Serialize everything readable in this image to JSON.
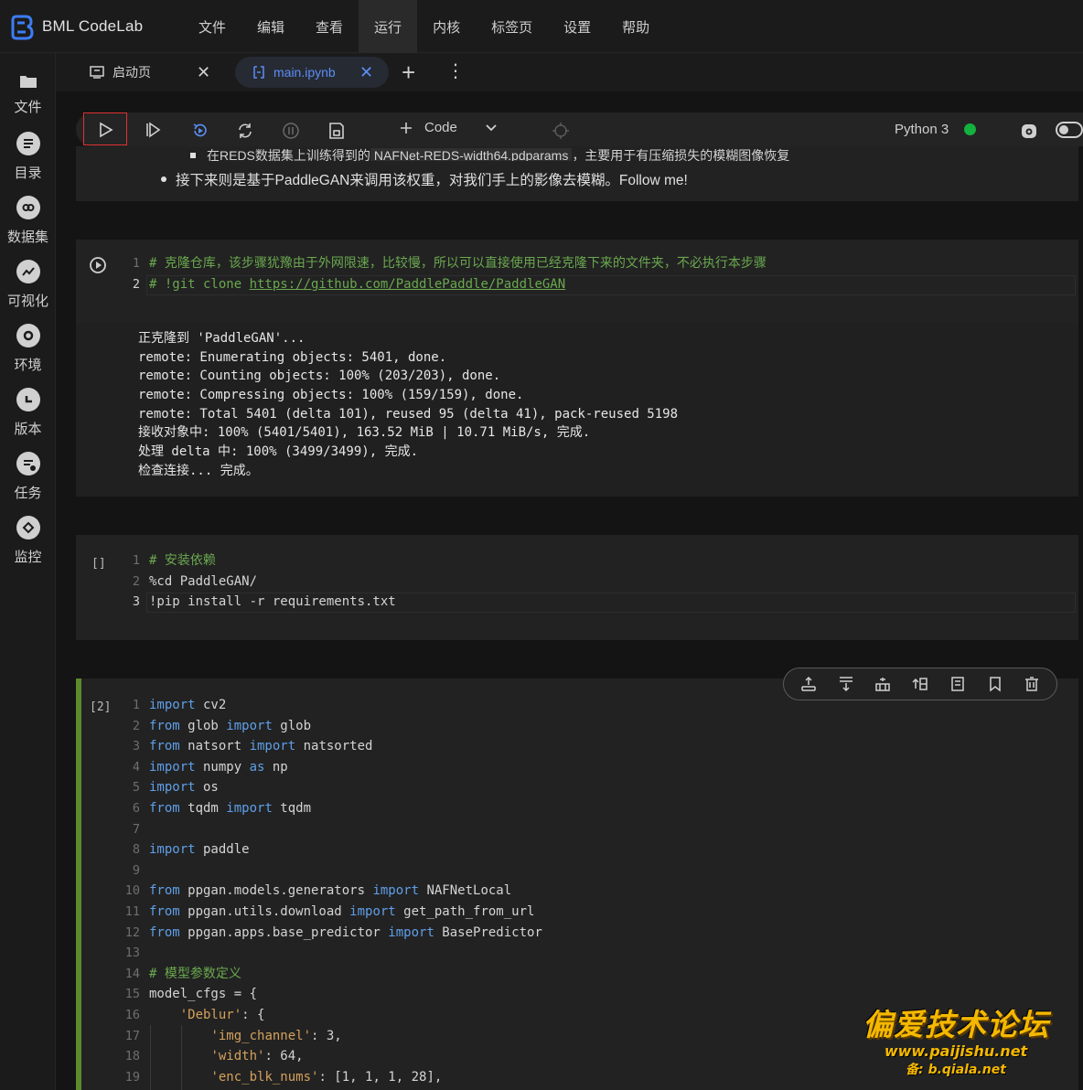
{
  "app": {
    "brand": "BML CodeLab"
  },
  "menu": [
    "文件",
    "编辑",
    "查看",
    "运行",
    "内核",
    "标签页",
    "设置",
    "帮助"
  ],
  "sidebar": [
    "文件",
    "目录",
    "数据集",
    "可视化",
    "环境",
    "版本",
    "任务",
    "监控"
  ],
  "tabs": {
    "start": "启动页",
    "notebook": "main.ipynb"
  },
  "toolbar": {
    "cell_type": "Code",
    "kernel": "Python 3",
    "kernel_status_color": "#13b13d"
  },
  "markdown": {
    "sub_prefix": "在REDS数据集上训练得到的",
    "sub_code": "NAFNet-REDS-width64.pdparams",
    "sub_suffix": "，主要用于有压缩损失的模糊图像恢复",
    "bullet": "接下来则是基于PaddleGAN来调用该权重，对我们手上的影像去模糊。Follow me!"
  },
  "cell1": {
    "line1": "# 克隆仓库，该步骤犹豫由于外网限速，比较慢，所以可以直接使用已经克隆下来的文件夹，不必执行本步骤",
    "line2_prefix": "# !git clone ",
    "line2_url": "https://github.com/PaddlePaddle/PaddleGAN"
  },
  "output": [
    "正克隆到 'PaddleGAN'...",
    "remote: Enumerating objects: 5401, done.",
    "remote: Counting objects: 100% (203/203), done.",
    "remote: Compressing objects: 100% (159/159), done.",
    "remote: Total 5401 (delta 101), reused 95 (delta 41), pack-reused 5198",
    "接收对象中: 100% (5401/5401), 163.52 MiB | 10.71 MiB/s, 完成.",
    "处理 delta 中: 100% (3499/3499), 完成.",
    "检查连接... 完成。"
  ],
  "cell2": {
    "prompt": "[]",
    "line1": "# 安装依赖",
    "line2": "%cd PaddleGAN/",
    "line3": "!pip install -r requirements.txt"
  },
  "cell3": {
    "prompt": "[2]",
    "c": {
      "import": "import",
      "from": "from",
      "as": "as",
      "cv2": " cv2",
      "glob_mod": " glob ",
      "glob_name": " glob",
      "natsort": " natsort ",
      "natsorted": " natsorted",
      "numpy": " numpy ",
      "np": " np",
      "os": " os",
      "tqdm_mod": " tqdm ",
      "tqdm_name": " tqdm",
      "paddle": " paddle",
      "gen_mod": " ppgan.models.generators ",
      "gen_name": " NAFNetLocal",
      "dl_mod": " ppgan.utils.download ",
      "dl_name": " get_path_from_url",
      "bp_mod": " ppgan.apps.base_predictor ",
      "bp_name": " BasePredictor",
      "comment14": "# 模型参数定义",
      "l15": "model_cfgs = {",
      "deblur_key": "'Deblur'",
      "deblur_rest": ": {",
      "img_key": "'img_channel'",
      "img_rest": ": 3,",
      "width_key": "'width'",
      "width_rest": ": 64,",
      "enc_key": "'enc_blk_nums'",
      "enc_rest": ": [1, 1, 1, 28],"
    }
  },
  "watermark": {
    "title": "偏爱技术论坛",
    "url": "www.paijishu.net",
    "sub": "备: b.qiala.net"
  }
}
